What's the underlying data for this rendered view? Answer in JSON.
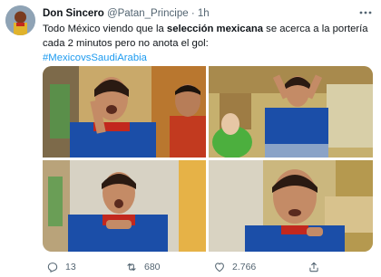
{
  "tweet": {
    "author_name": "Don Sincero",
    "handle": "@Patan_Principe",
    "separator": "·",
    "time": "1h",
    "text_part1": "Todo México viendo que la ",
    "text_bold": "selección mexicana",
    "text_part2": " se acerca a la portería cada 2 minutos pero no anota el gol:",
    "hashtag": "#MexicovsSaudiArabia"
  },
  "stats": {
    "replies": "13",
    "retweets": "680",
    "likes": "2.766"
  },
  "colors": {
    "accent": "#1d9bf0",
    "secondary_text": "#536471",
    "jersey_blue": "#1b4ea8"
  },
  "icons": [
    "more-icon",
    "reply-icon",
    "retweet-icon",
    "like-icon",
    "share-icon"
  ]
}
